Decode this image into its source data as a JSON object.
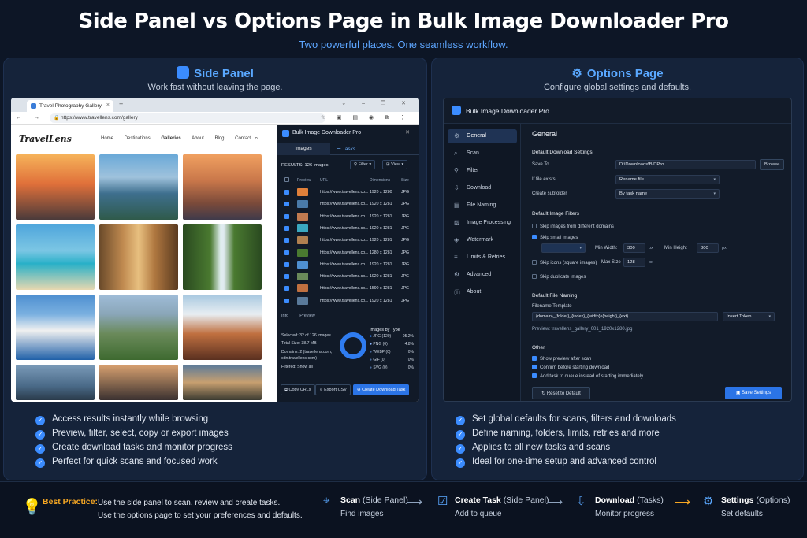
{
  "header": {
    "title": "Side Panel vs Options Page in Bulk Image Downloader Pro",
    "subtitle": "Two powerful places. One seamless workflow."
  },
  "left": {
    "title": "Side Panel",
    "subtitle": "Work fast without leaving the page.",
    "browser": {
      "tab": "Travel Photography Gallery",
      "url": "https://www.travellens.com/gallery"
    },
    "site": {
      "logo": "TravelLens",
      "nav": [
        "Home",
        "Destinations",
        "Galleries",
        "About",
        "Blog",
        "Contact"
      ]
    },
    "panel": {
      "title": "Bulk Image Downloader Pro",
      "tab_images": "Images",
      "tab_tasks": "Tasks",
      "results": "RESULTS: 126 images",
      "filter": "Filter",
      "view": "View",
      "cols": [
        "Preview",
        "URL",
        "Dimensions",
        "Size"
      ],
      "rows": [
        {
          "url": "https://www.travellens.co...",
          "dim": "1920 x 1280",
          "ext": "JPG",
          "on": true
        },
        {
          "url": "https://www.travellens.co...",
          "dim": "1920 x 1281",
          "ext": "JPG",
          "on": true
        },
        {
          "url": "https://www.travellens.co...",
          "dim": "1920 x 1281",
          "ext": "JPG",
          "on": true
        },
        {
          "url": "https://www.travellens.co...",
          "dim": "1920 x 1281",
          "ext": "JPG",
          "on": true
        },
        {
          "url": "https://www.travellens.co...",
          "dim": "1920 x 1281",
          "ext": "JPG",
          "on": true
        },
        {
          "url": "https://www.travellens.co...",
          "dim": "1280 x 1281",
          "ext": "JPG",
          "on": true
        },
        {
          "url": "https://www.travellens.co...",
          "dim": "1920 x 1281",
          "ext": "JPG",
          "on": true
        },
        {
          "url": "https://www.travellens.co...",
          "dim": "1920 x 1281",
          "ext": "JPG",
          "on": true
        },
        {
          "url": "https://www.travellens.co...",
          "dim": "1590 x 1281",
          "ext": "JPG",
          "on": true
        },
        {
          "url": "https://www.travellens.co...",
          "dim": "1920 x 1281",
          "ext": "JPG",
          "on": true
        }
      ],
      "info_tab": "Info",
      "preview_tab": "Preview",
      "selected": "Selected: 32 of 126 images",
      "total": "Total Size: 38.7 MB",
      "domains": "Domains: 2 (travellens.com, cdn.travellens.com)",
      "filtered": "Filtered: Show all",
      "types_title": "Images by Type",
      "types": [
        {
          "name": "JPG (120)",
          "pct": "95.2%"
        },
        {
          "name": "PNG (6)",
          "pct": "4.8%"
        },
        {
          "name": "WEBP (0)",
          "pct": "0%"
        },
        {
          "name": "GIF (0)",
          "pct": "0%"
        },
        {
          "name": "SVG (0)",
          "pct": "0%"
        }
      ],
      "copy": "Copy URLs",
      "export": "Export CSV",
      "create": "Create Download Task"
    },
    "bullets": [
      "Access results instantly while browsing",
      "Preview, filter, select, copy or export images",
      "Create download tasks and monitor progress",
      "Perfect for quick scans and focused work"
    ]
  },
  "right": {
    "title": "Options Page",
    "subtitle": "Configure global settings and defaults.",
    "window_title": "Bulk Image Downloader Pro",
    "nav": [
      "General",
      "Scan",
      "Filter",
      "Download",
      "File Naming",
      "Image Processing",
      "Watermark",
      "Limits & Retries",
      "Advanced",
      "About"
    ],
    "nav_icons": [
      "⚙",
      "⌕",
      "⚲",
      "⇩",
      "▤",
      "▧",
      "◈",
      "≡",
      "⚙",
      "ⓘ"
    ],
    "general": "General",
    "dl_settings": "Default Download Settings",
    "save_to": "Save To",
    "save_path": "D:\\Downloads\\BIDPro",
    "browse": "Browse",
    "if_exists": "If file exists",
    "rename": "Rename file",
    "create_sub": "Create subfolder",
    "by_task": "By task name",
    "filters": "Default Image Filters",
    "skip_domains": "Skip images from different domains",
    "skip_small": "Skip small images",
    "min_w": "Min Width:",
    "min_w_val": "300",
    "min_h": "Min Height",
    "min_h_val": "300",
    "px": "px",
    "skip_icons": "Skip icons (square images)",
    "max_size": "Max Size",
    "max_val": "128",
    "skip_dup": "Skip duplicate images",
    "naming": "Default File Naming",
    "template_label": "Filename Template",
    "template": "{domain}_{folder}_{index}_{width}x{height}_{ext}",
    "insert": "Insert Token",
    "preview": "Preview:   travellens_gallery_001_1920x1280.jpg",
    "other": "Other",
    "o1": "Show preview after scan",
    "o2": "Confirm before starting download",
    "o3": "Add task to queue instead of starting immediately",
    "reset": "Reset to Default",
    "save": "Save Settings",
    "bullets": [
      "Set global defaults for scans, filters and downloads",
      "Define naming, folders, limits, retries and more",
      "Applies to all new tasks and scans",
      "Ideal for one-time setup and advanced control"
    ]
  },
  "footer": {
    "bp": "Best Practice:",
    "bp1": "Use the side panel to scan, review and create tasks.",
    "bp2": "Use the options page to set your preferences and defaults.",
    "steps": [
      {
        "b": "Scan",
        "s": "(Side Panel)",
        "d": "Find images"
      },
      {
        "b": "Create Task",
        "s": "(Side Panel)",
        "d": "Add to queue"
      },
      {
        "b": "Download",
        "s": "(Tasks)",
        "d": "Monitor progress"
      },
      {
        "b": "Settings",
        "s": "(Options)",
        "d": "Set defaults"
      }
    ]
  },
  "colors": {
    "accent": "#3b8cff",
    "bg": "#0d1626",
    "panel": "#15233a",
    "best_practice": "#f5a623"
  }
}
